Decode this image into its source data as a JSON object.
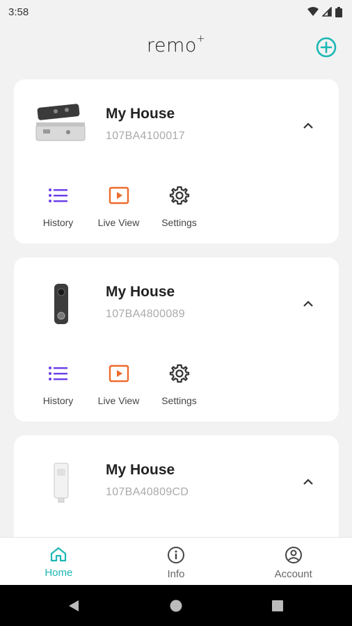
{
  "status_bar": {
    "time": "3:58"
  },
  "header": {
    "logo_text": "remo",
    "logo_superscript": "+"
  },
  "devices": [
    {
      "title": "My House",
      "serial": "107BA4100017"
    },
    {
      "title": "My House",
      "serial": "107BA4800089"
    },
    {
      "title": "My House",
      "serial": "107BA40809CD"
    }
  ],
  "actions": {
    "history": "History",
    "live_view": "Live View",
    "settings": "Settings"
  },
  "nav": {
    "home": "Home",
    "info": "Info",
    "account": "Account"
  },
  "colors": {
    "accent": "#1bb7b4",
    "history": "#6a3de8",
    "live_view": "#ee6a2c",
    "settings": "#333333"
  }
}
